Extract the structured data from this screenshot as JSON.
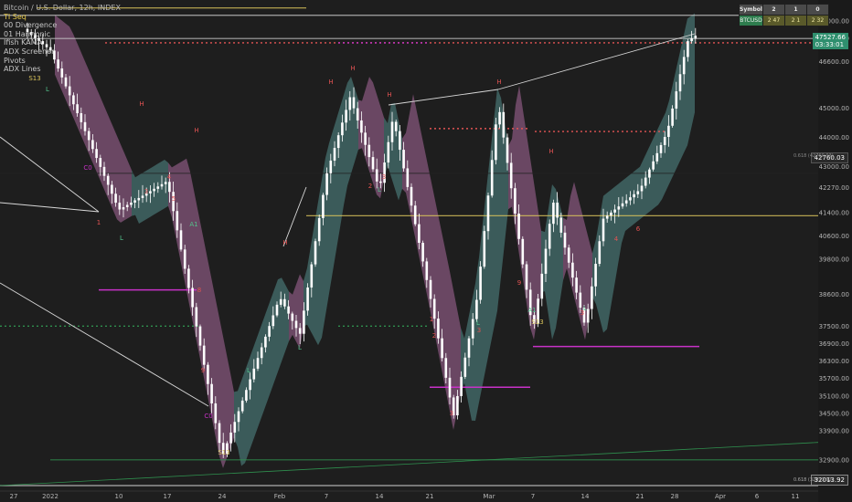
{
  "legend": {
    "title": "Bitcoin / U.S. Dollar, 12h, INDEX",
    "indicators": [
      "TI Seq",
      "00 Divergence",
      "01 Harmonic",
      "Ifish KAMA",
      "ADX Screener",
      "Pivots",
      "ADX Lines"
    ]
  },
  "table": {
    "headers": [
      "Symbol",
      "2",
      "1",
      "0"
    ],
    "row": [
      "BTCUSD",
      "2 47",
      "2 1",
      "2 32"
    ]
  },
  "price_tags": {
    "current": "47527.66",
    "countdown": "03:33:01",
    "mid": "42760.03",
    "bottom": "32013.92",
    "fib_mid": "0.618 (42760.03)",
    "fib_bottom": "0.618 (32013.92)"
  },
  "colors": {
    "background": "#1e1e1e",
    "candle": "#ffffff",
    "cloud_bear": "#c77ab8",
    "cloud_bull": "#5fa6a3",
    "label_red": "#e35353",
    "label_green": "#53c28b",
    "pivot_magenta": "#c832c8",
    "level_yellow": "#d8c25a",
    "trend_green": "#2f8f4e"
  },
  "chart_data": {
    "type": "candlestick",
    "symbol": "BTCUSD",
    "timeframe": "12h",
    "ylim": [
      32013.92,
      48600
    ],
    "x_tick_labels": [
      "27",
      "2022",
      "10",
      "17",
      "24",
      "Feb",
      "7",
      "14",
      "21",
      "Mar",
      "7",
      "14",
      "21",
      "28",
      "Apr",
      "6",
      "11"
    ],
    "y_tick_labels": [
      "48000.00",
      "47400.00",
      "46600.00",
      "45000.00",
      "44000.00",
      "43000.00",
      "42270.00",
      "41400.00",
      "40600.00",
      "39800.00",
      "38600.00",
      "37500.00",
      "36900.00",
      "36300.00",
      "35700.00",
      "35100.00",
      "34500.00",
      "33900.00",
      "32900.00"
    ],
    "key_points": [
      {
        "x": "Dec 27",
        "y": 48000
      },
      {
        "x": "Jan 1",
        "y": 47000
      },
      {
        "x": "Jan 10",
        "y": 41500
      },
      {
        "x": "Jan 17",
        "y": 42500
      },
      {
        "x": "Jan 22",
        "y": 35100
      },
      {
        "x": "Jan 24",
        "y": 33000
      },
      {
        "x": "Feb 1",
        "y": 38500
      },
      {
        "x": "Feb 4",
        "y": 37200
      },
      {
        "x": "Feb 7",
        "y": 42700
      },
      {
        "x": "Feb 10",
        "y": 45400
      },
      {
        "x": "Feb 14",
        "y": 42200
      },
      {
        "x": "Feb 16",
        "y": 44700
      },
      {
        "x": "Feb 21",
        "y": 38600
      },
      {
        "x": "Feb 24",
        "y": 34400
      },
      {
        "x": "Feb 27",
        "y": 38500
      },
      {
        "x": "Mar 2",
        "y": 45200
      },
      {
        "x": "Mar 7",
        "y": 37300
      },
      {
        "x": "Mar 10",
        "y": 41800
      },
      {
        "x": "Mar 14",
        "y": 37500
      },
      {
        "x": "Mar 17",
        "y": 41200
      },
      {
        "x": "Mar 21",
        "y": 42200
      },
      {
        "x": "Mar 25",
        "y": 44200
      },
      {
        "x": "Mar 28",
        "y": 47300
      },
      {
        "x": "Mar 29",
        "y": 47527.66
      }
    ],
    "horizontal_levels": [
      {
        "value": 48200,
        "color": "#c8c8c8"
      },
      {
        "value": 47400,
        "color": "#c8c8c8"
      },
      {
        "value": 42760.03,
        "color": "#222222"
      },
      {
        "value": 41300,
        "color": "#d8c25a"
      },
      {
        "value": 32900,
        "color": "#2f8f4e"
      },
      {
        "value": 32013.92,
        "color": "#cfcfcf"
      }
    ],
    "grid": false,
    "legend_position": "top-left"
  }
}
